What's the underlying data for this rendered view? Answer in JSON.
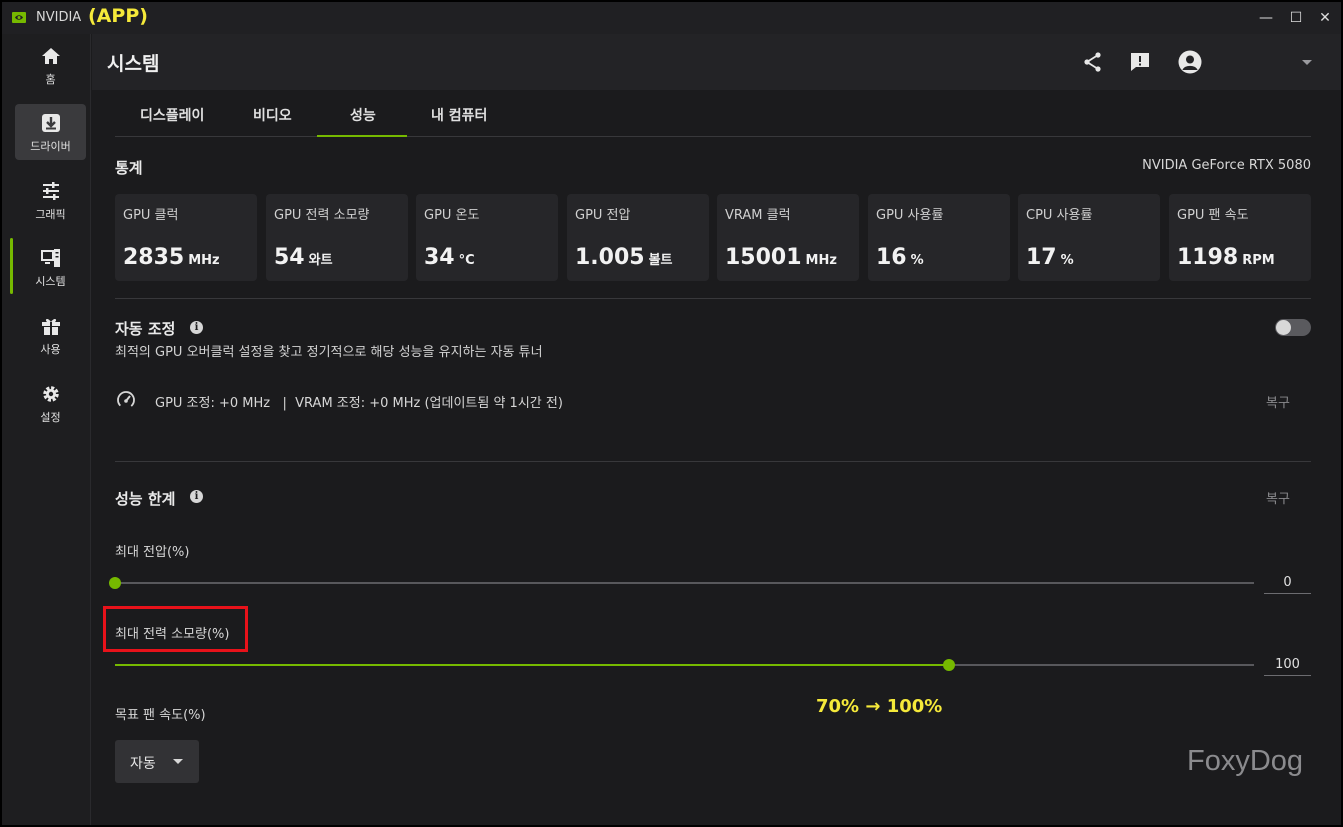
{
  "app": {
    "title": "NVIDIA",
    "annotation": "(APP)"
  },
  "window_controls": {
    "minimize": "—",
    "maximize": "☐",
    "close": "✕"
  },
  "sidebar": {
    "items": [
      {
        "label": "홈",
        "icon": "home-icon"
      },
      {
        "label": "드라이버",
        "icon": "download-icon"
      },
      {
        "label": "그래픽",
        "icon": "sliders-icon"
      },
      {
        "label": "시스템",
        "icon": "system-icon",
        "active": true
      },
      {
        "label": "사용",
        "icon": "gift-icon"
      },
      {
        "label": "설정",
        "icon": "gear-icon"
      }
    ]
  },
  "header": {
    "title": "시스템"
  },
  "tabs": [
    {
      "label": "디스플레이"
    },
    {
      "label": "비디오"
    },
    {
      "label": "성능",
      "active": true
    },
    {
      "label": "내 컴퓨터"
    }
  ],
  "stats": {
    "title": "통계",
    "gpu_name": "NVIDIA GeForce RTX 5080",
    "items": [
      {
        "label": "GPU 클럭",
        "value": "2835",
        "unit": "MHz"
      },
      {
        "label": "GPU 전력 소모량",
        "value": "54",
        "unit": "와트"
      },
      {
        "label": "GPU 온도",
        "value": "34",
        "unit": "°C"
      },
      {
        "label": "GPU 전압",
        "value": "1.005",
        "unit": "볼트"
      },
      {
        "label": "VRAM 클럭",
        "value": "15001",
        "unit": "MHz"
      },
      {
        "label": "GPU 사용률",
        "value": "16",
        "unit": "%"
      },
      {
        "label": "CPU 사용률",
        "value": "17",
        "unit": "%"
      },
      {
        "label": "GPU 팬 속도",
        "value": "1198",
        "unit": "RPM"
      }
    ]
  },
  "auto_tune": {
    "title": "자동 조정",
    "description": "최적의 GPU 오버클럭 설정을 찾고 정기적으로 해당 성능을 유지하는 자동 튜너",
    "enabled": false,
    "status": "GPU 조정: +0 MHz   |  VRAM 조정: +0 MHz (업데이트됨 약 1시간 전)",
    "reset_label": "복구"
  },
  "limits": {
    "title": "성능 한계",
    "reset_label": "복구",
    "max_voltage": {
      "label": "최대 전압(%)",
      "value": "0",
      "fraction": 0.0
    },
    "max_power": {
      "label": "최대 전력 소모량(%)",
      "value": "100",
      "fraction": 0.732
    },
    "fan_target": {
      "label": "목표 팬 속도(%)",
      "selected": "자동"
    }
  },
  "annotation": "70% → 100%",
  "watermark": "FoxyDog",
  "colors": {
    "accent": "#76b900",
    "highlight": "#e8121a",
    "annotation": "#f5e93a"
  }
}
